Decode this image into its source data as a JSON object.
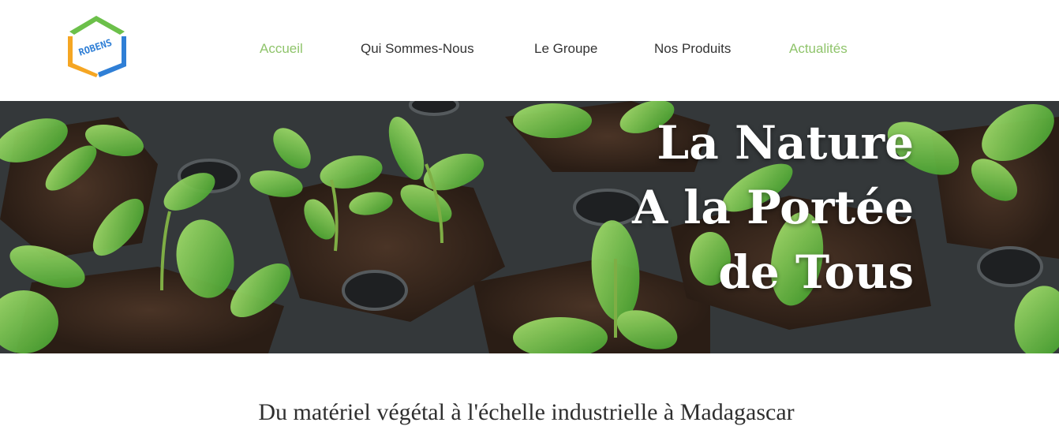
{
  "brand": {
    "logo_text": "ROBENS"
  },
  "nav": {
    "items": [
      {
        "label": "Accueil",
        "active": true
      },
      {
        "label": "Qui Sommes-Nous",
        "active": false
      },
      {
        "label": "Le Groupe",
        "active": false
      },
      {
        "label": "Nos Produits",
        "active": false
      },
      {
        "label": "Actualités",
        "active": true
      }
    ]
  },
  "hero": {
    "title_lines": [
      "La Nature",
      "A la Portée",
      "de Tous"
    ]
  },
  "tagline": "Du matériel végétal à l'échelle industrielle à Madagascar",
  "colors": {
    "accent_green": "#8fc46b",
    "nav_text": "#333333",
    "logo_green": "#6cc04a",
    "logo_orange": "#f5a623",
    "logo_blue": "#2f7fd6"
  }
}
